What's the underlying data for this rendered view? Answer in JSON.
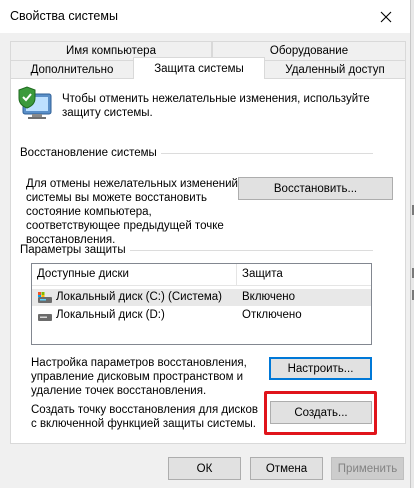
{
  "window": {
    "title": "Свойства системы"
  },
  "tabs": {
    "row_top": [
      {
        "label": "Имя компьютера"
      },
      {
        "label": "Оборудование"
      }
    ],
    "row_bottom": [
      {
        "label": "Дополнительно"
      },
      {
        "label": "Защита системы",
        "selected": true
      },
      {
        "label": "Удаленный доступ"
      }
    ]
  },
  "intro": {
    "text": "Чтобы отменить нежелательные изменения, используйте защиту системы."
  },
  "restore": {
    "group_label": "Восстановление системы",
    "description": "Для отмены нежелательных изменений системы вы можете восстановить состояние компьютера, соответствующее предыдущей точке восстановления.",
    "button_label": "Восстановить..."
  },
  "protection": {
    "group_label": "Параметры защиты",
    "columns": [
      "Доступные диски",
      "Защита"
    ],
    "rows": [
      {
        "disk": "Локальный диск (C:) (Система)",
        "status": "Включено",
        "icon": "system-drive-icon",
        "selected": true
      },
      {
        "disk": "Локальный диск (D:)",
        "status": "Отключено",
        "icon": "drive-icon",
        "selected": false
      }
    ],
    "configure_text": "Настройка параметров восстановления, управление дисковым пространством и удаление точек восстановления.",
    "configure_button": "Настроить...",
    "create_text": "Создать точку восстановления для дисков с включенной функцией защиты системы.",
    "create_button": "Создать..."
  },
  "footer": {
    "ok": "ОК",
    "cancel": "Отмена",
    "apply": "Применить"
  },
  "colors": {
    "accent": "#0078d7",
    "highlight": "#e0141b",
    "dialog_bg": "#f0f0f0"
  }
}
